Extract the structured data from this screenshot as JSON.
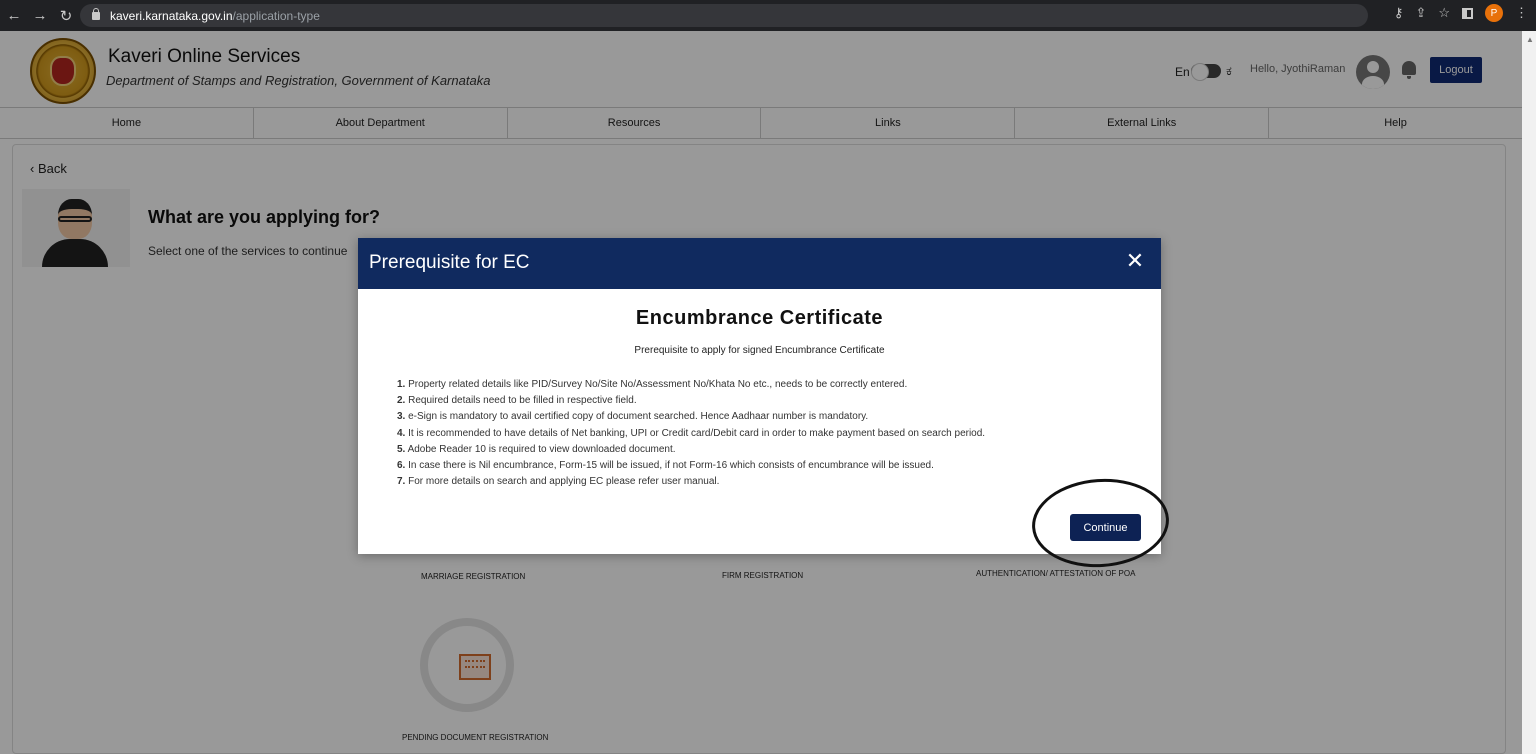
{
  "browser": {
    "url_host": "kaveri.karnataka.gov.in",
    "url_path": "/application-type",
    "profile_initial": "P"
  },
  "header": {
    "title": "Kaveri Online Services",
    "subtitle": "Department of Stamps and Registration, Government of Karnataka",
    "lang_en": "En",
    "lang_kn": "ಕ",
    "greeting": "Hello, JyothiRaman",
    "logout_label": "Logout"
  },
  "menu": {
    "items": [
      {
        "label": "Home"
      },
      {
        "label": "About Department"
      },
      {
        "label": "Resources"
      },
      {
        "label": "Links"
      },
      {
        "label": "External Links"
      },
      {
        "label": "Help"
      }
    ]
  },
  "main": {
    "back_label": "Back",
    "title": "What are you applying for?",
    "subtitle": "Select one of the services to continue",
    "services": [
      {
        "label": "MARRIAGE REGISTRATION"
      },
      {
        "label": "FIRM REGISTRATION"
      },
      {
        "label": "AUTHENTICATION/ ATTESTATION OF POA"
      },
      {
        "label": "PENDING DOCUMENT REGISTRATION"
      }
    ]
  },
  "modal": {
    "title": "Prerequisite for EC",
    "close_glyph": "✕",
    "heading": "Encumbrance Certificate",
    "subheading": "Prerequisite to apply for signed Encumbrance Certificate",
    "items": [
      {
        "num": "1.",
        "text": " Property related details like PID/Survey No/Site No/Assessment No/Khata No etc., needs to be correctly entered."
      },
      {
        "num": "2.",
        "text": " Required details need to be filled in respective field."
      },
      {
        "num": "3.",
        "text": " e-Sign is mandatory to avail certified copy of document searched. Hence Aadhaar number is mandatory."
      },
      {
        "num": "4.",
        "text": " It is recommended to have details of Net banking, UPI or Credit card/Debit card in order to make payment based on search period."
      },
      {
        "num": "5.",
        "text": " Adobe Reader 10 is required to view downloaded document."
      },
      {
        "num": "6.",
        "text": " In case there is Nil encumbrance, Form-15 will be issued, if not Form-16 which consists of encumbrance will be issued."
      },
      {
        "num": "7.",
        "text": " For more details on search and applying EC please refer user manual."
      }
    ],
    "continue_label": "Continue"
  },
  "colors": {
    "modal_header": "#102a5f",
    "primary_button": "#0d2254",
    "overlay": "rgba(0,0,0,0.4)"
  }
}
